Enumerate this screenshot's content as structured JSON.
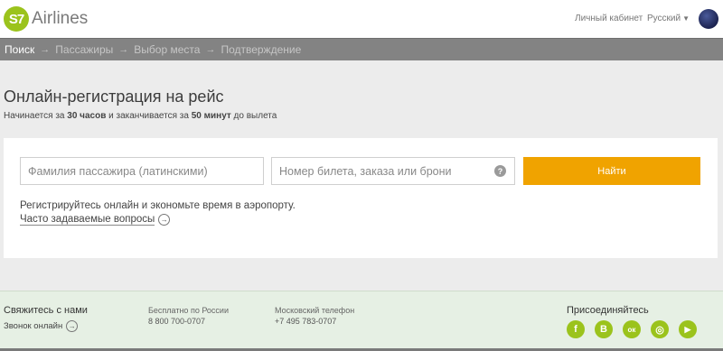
{
  "header": {
    "logo_mark": "S7",
    "logo_text": "Airlines",
    "cabinet_link": "Личный кабинет",
    "language": "Русский"
  },
  "steps": [
    {
      "label": "Поиск",
      "active": true
    },
    {
      "label": "Пассажиры",
      "active": false
    },
    {
      "label": "Выбор места",
      "active": false
    },
    {
      "label": "Подтверждение",
      "active": false
    }
  ],
  "main": {
    "title": "Онлайн-регистрация на рейс",
    "subtitle_pre": "Начинается за ",
    "subtitle_hours": "30 часов",
    "subtitle_mid": " и заканчивается за ",
    "subtitle_minutes": "50 минут",
    "subtitle_post": " до вылета"
  },
  "form": {
    "name_placeholder": "Фамилия пассажира (латинскими)",
    "ticket_placeholder": "Номер билета, заказа или брони",
    "help_glyph": "?",
    "find_label": "Найти",
    "promo": "Регистрируйтесь онлайн и экономьте время в аэропорту.",
    "faq_link": "Часто задаваемые вопросы"
  },
  "footer": {
    "contact_title": "Свяжитесь с нами",
    "call_online": "Звонок онлайн",
    "russia_label": "Бесплатно по России",
    "russia_phone": "8 800 700-0707",
    "moscow_label": "Московский телефон",
    "moscow_phone": "+7 495 783-0707",
    "join_title": "Присоединяйтесь",
    "socials": [
      {
        "name": "facebook-icon",
        "glyph": "f"
      },
      {
        "name": "vkontakte-icon",
        "glyph": "B"
      },
      {
        "name": "odnoklassniki-icon",
        "glyph": "ок"
      },
      {
        "name": "instagram-icon",
        "glyph": "◎"
      },
      {
        "name": "youtube-icon",
        "glyph": "▶"
      }
    ]
  },
  "colors": {
    "brand_green": "#9bc31c",
    "accent_orange": "#f0a300",
    "steps_bar": "#838383"
  }
}
